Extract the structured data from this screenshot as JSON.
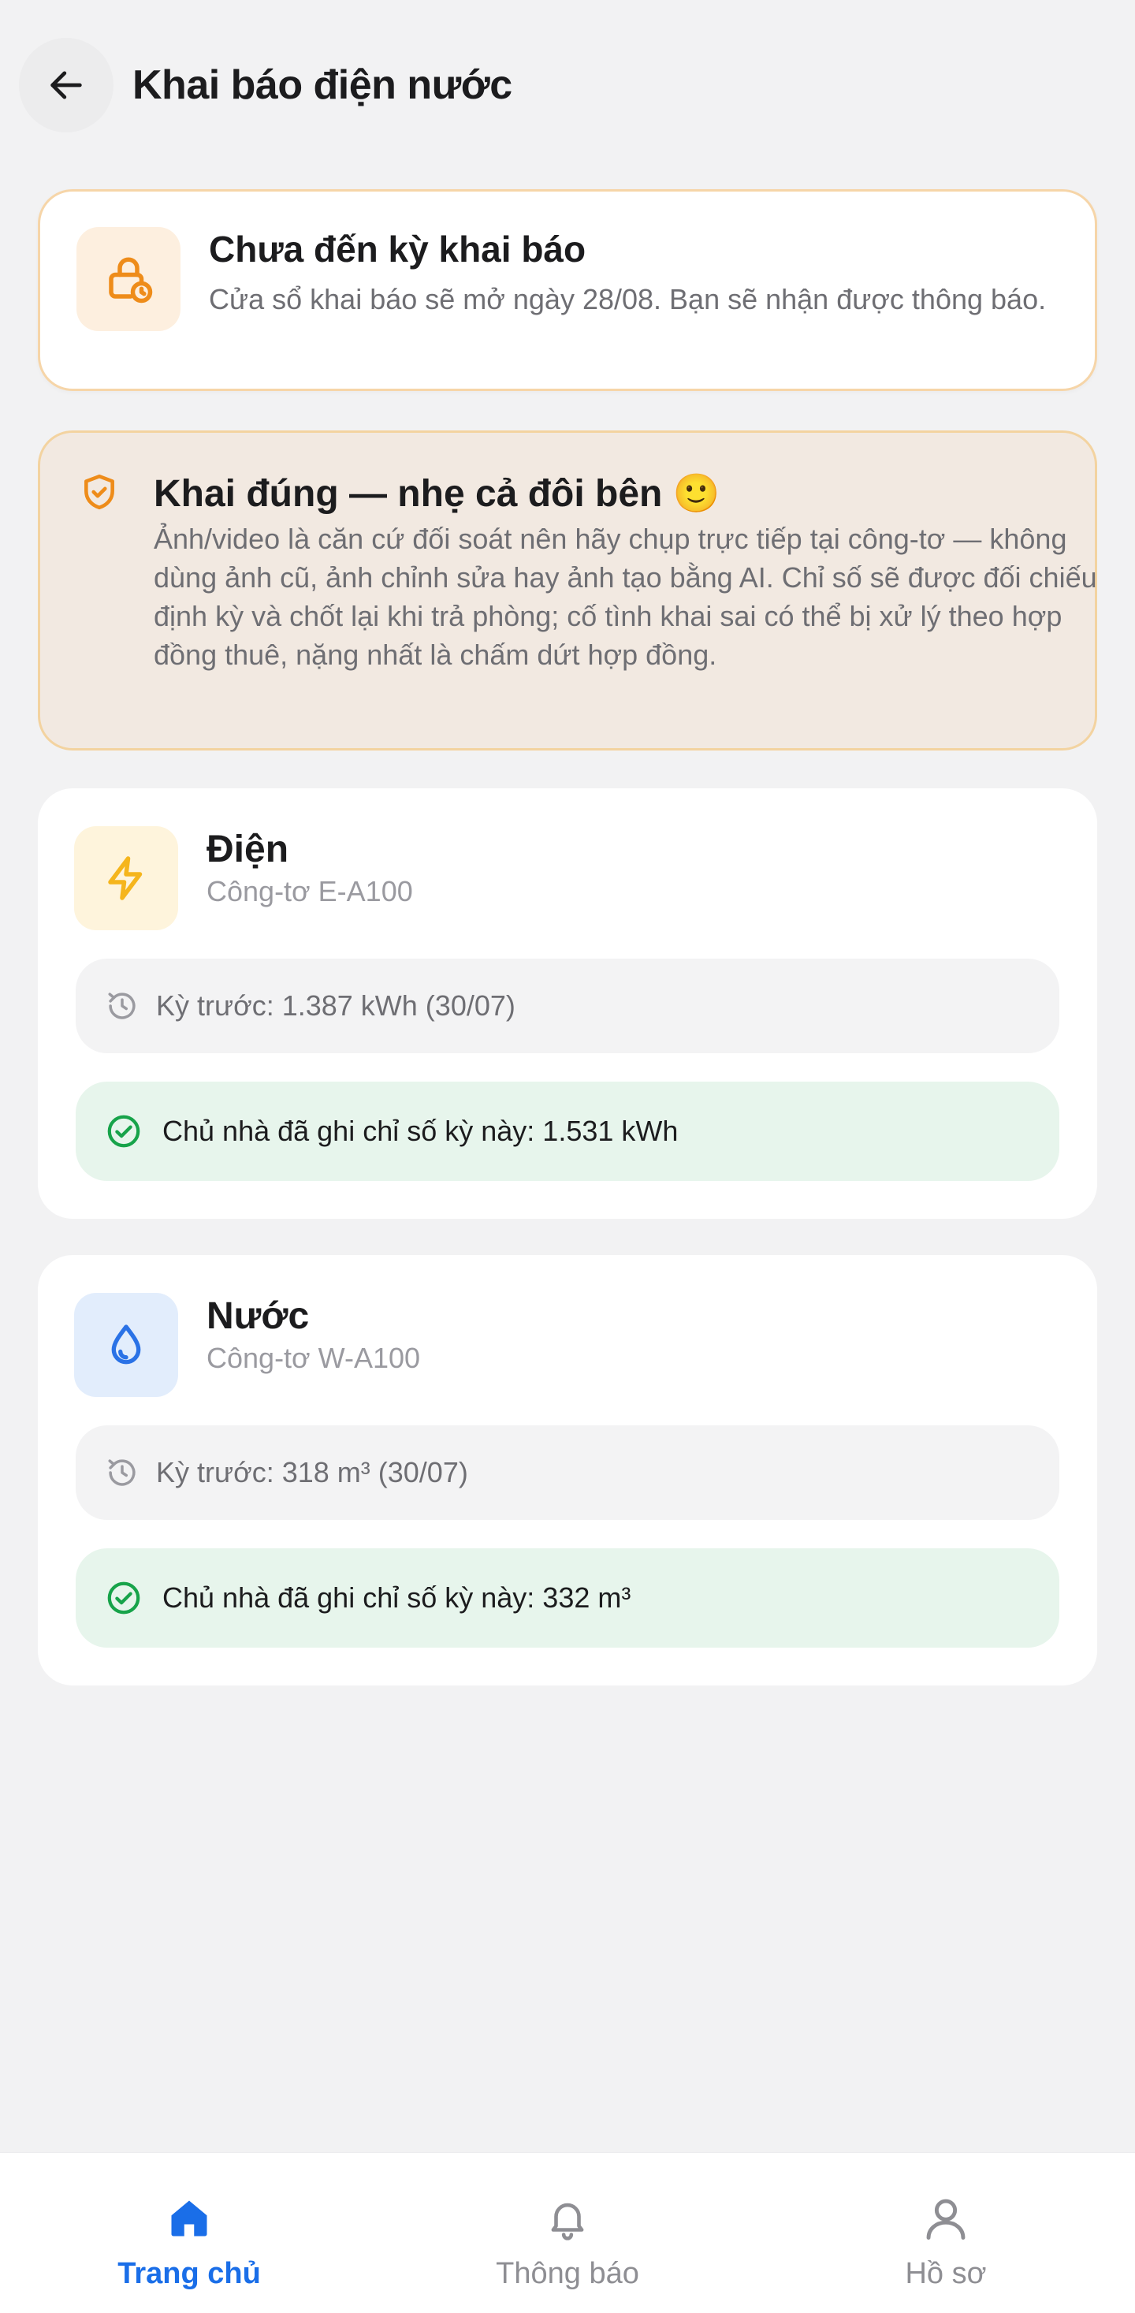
{
  "header": {
    "title": "Khai báo điện nước",
    "back_icon": "arrow-left-icon"
  },
  "notice": {
    "icon": "lock-clock-icon",
    "title": "Chưa đến kỳ khai báo",
    "description": "Cửa sổ khai báo sẽ mở ngày 28/08. Bạn sẽ nhận được thông báo."
  },
  "warning": {
    "icon": "shield-check-icon",
    "title": "Khai đúng — nhẹ cả đôi bên 🙂",
    "description": "Ảnh/video là căn cứ đối soát nên hãy chụp trực tiếp tại công-tơ — không dùng ảnh cũ, ảnh chỉnh sửa hay ảnh tạo bằng AI. Chỉ số sẽ được đối chiếu định kỳ và chốt lại khi trả phòng; cố tình khai sai có thể bị xử lý theo hợp đồng thuê, nặng nhất là chấm dứt hợp đồng."
  },
  "meters": {
    "electric": {
      "icon": "lightning-icon",
      "title": "Điện",
      "meter_id": "Công-tơ E-A100",
      "previous": "Kỳ trước: 1.387 kWh (30/07)",
      "current": "Chủ nhà đã ghi chỉ số kỳ này: 1.531 kWh"
    },
    "water": {
      "icon": "water-drop-icon",
      "title": "Nước",
      "meter_id": "Công-tơ W-A100",
      "previous": "Kỳ trước: 318 m³ (30/07)",
      "current": "Chủ nhà đã ghi chỉ số kỳ này: 332 m³"
    }
  },
  "bottom_nav": {
    "home": "Trang chủ",
    "notifications": "Thông báo",
    "profile": "Hồ sơ",
    "active": "home"
  },
  "colors": {
    "accent": "#1a6ee8",
    "warning_orange": "#ee8c1a",
    "electric_yellow": "#f5b51c",
    "water_blue": "#2a72e6",
    "success_green": "#17a34a"
  }
}
